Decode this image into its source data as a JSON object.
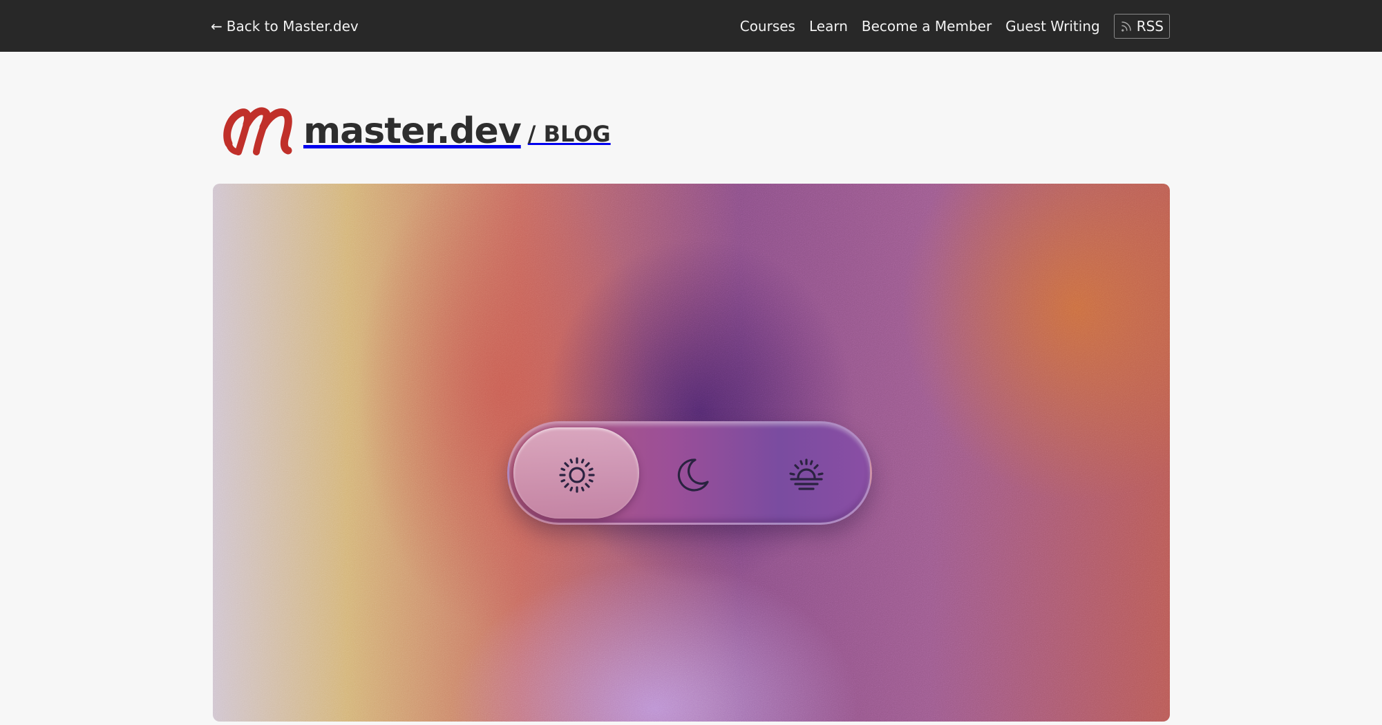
{
  "topbar": {
    "back_arrow": "←",
    "back_label": "Back to Master.dev",
    "nav": [
      {
        "label": "Courses"
      },
      {
        "label": "Learn"
      },
      {
        "label": "Become a Member"
      },
      {
        "label": "Guest Writing"
      }
    ],
    "rss_label": "RSS"
  },
  "brand": {
    "name": "master.dev",
    "section": "/ BLOG",
    "logo_color": "#c0302a"
  },
  "hero": {
    "theme_options": [
      {
        "icon": "sun-icon",
        "selected": true
      },
      {
        "icon": "moon-icon",
        "selected": false
      },
      {
        "icon": "sunrise-icon",
        "selected": false
      }
    ]
  }
}
